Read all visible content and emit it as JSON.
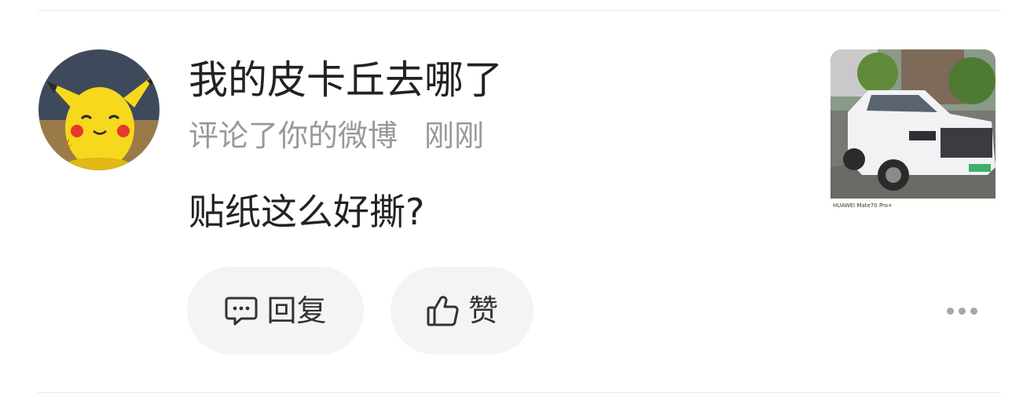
{
  "notification": {
    "username": "我的皮卡丘去哪了",
    "action_text": "评论了你的微博",
    "time": "刚刚",
    "comment_text": "贴纸这么好撕?",
    "avatar": {
      "icon": "pikachu-avatar"
    },
    "thumbnail": {
      "icon": "white-suv-photo",
      "caption": "HUAWEI Mate70 Pro+"
    }
  },
  "actions": {
    "reply": {
      "label": "回复",
      "icon": "comment-icon"
    },
    "like": {
      "label": "赞",
      "icon": "thumbs-up-icon"
    },
    "more": {
      "icon": "more-dots-icon"
    }
  },
  "colors": {
    "primary_text": "#222222",
    "secondary_text": "#999999",
    "pill_bg": "#f4f4f4",
    "divider": "#e9e9e9"
  }
}
